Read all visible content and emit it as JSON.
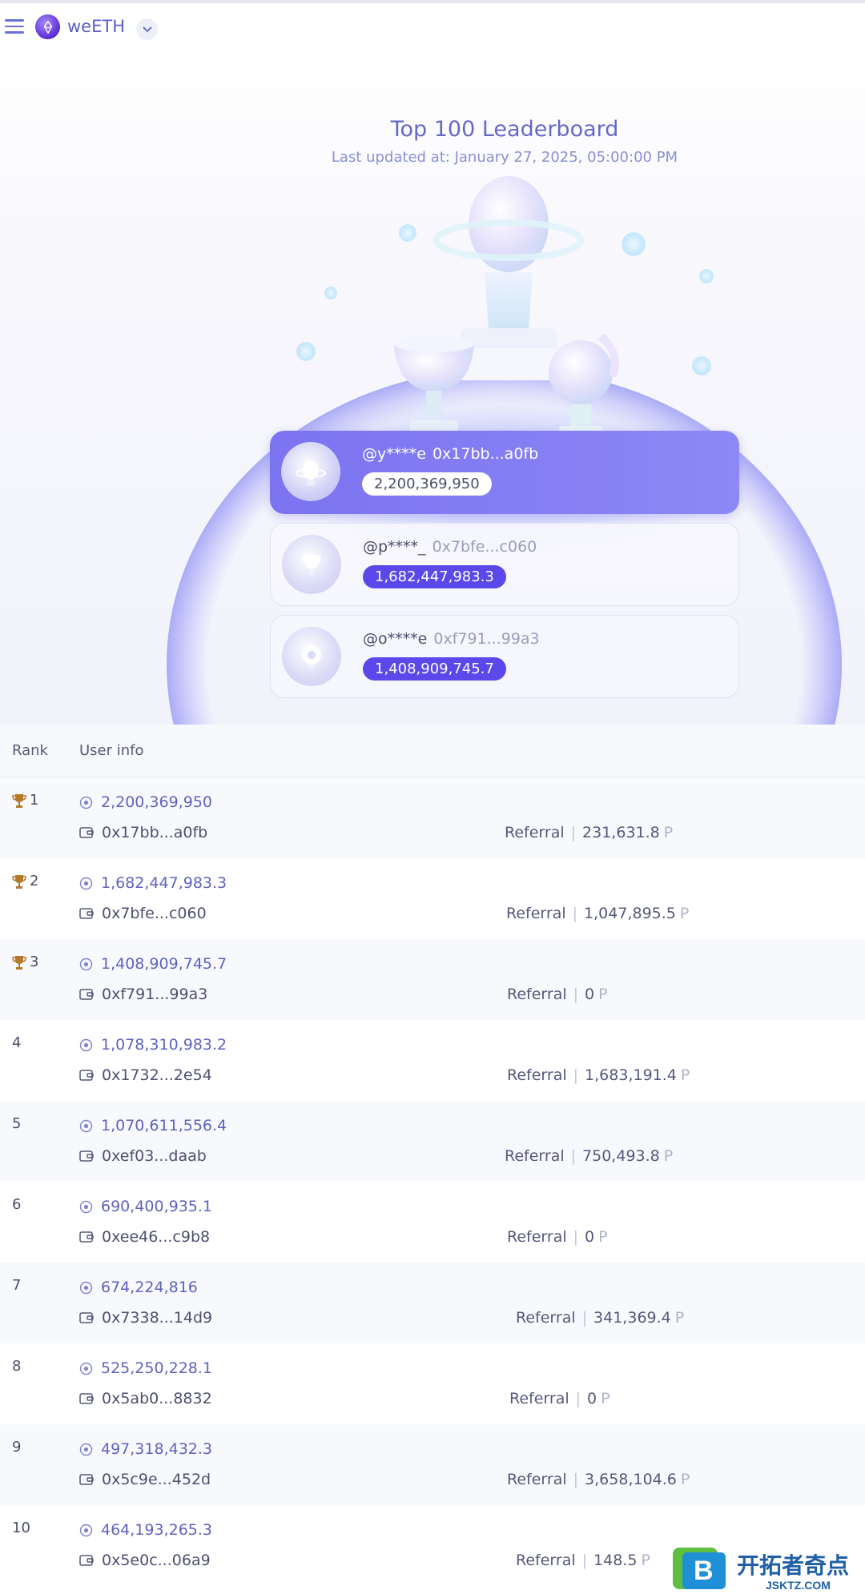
{
  "header": {
    "token": "weETH"
  },
  "hero": {
    "title": "Top 100 Leaderboard",
    "subtitle": "Last updated at: January 27, 2025, 05:00:00 PM"
  },
  "podium": [
    {
      "handle": "@y****e",
      "address": "0x17bb...a0fb",
      "score": "2,200,369,950"
    },
    {
      "handle": "@p****_",
      "address": "0x7bfe...c060",
      "score": "1,682,447,983.3"
    },
    {
      "handle": "@o****e",
      "address": "0xf791...99a3",
      "score": "1,408,909,745.7"
    }
  ],
  "table": {
    "col_rank": "Rank",
    "col_user": "User info",
    "referral_label": "Referral",
    "unit": "P",
    "rows": [
      {
        "rank": "1",
        "trophy": true,
        "points": "2,200,369,950",
        "address": "0x17bb...a0fb",
        "referral": "231,631.8"
      },
      {
        "rank": "2",
        "trophy": true,
        "points": "1,682,447,983.3",
        "address": "0x7bfe...c060",
        "referral": "1,047,895.5"
      },
      {
        "rank": "3",
        "trophy": true,
        "points": "1,408,909,745.7",
        "address": "0xf791...99a3",
        "referral": "0"
      },
      {
        "rank": "4",
        "trophy": false,
        "points": "1,078,310,983.2",
        "address": "0x1732...2e54",
        "referral": "1,683,191.4"
      },
      {
        "rank": "5",
        "trophy": false,
        "points": "1,070,611,556.4",
        "address": "0xef03...daab",
        "referral": "750,493.8"
      },
      {
        "rank": "6",
        "trophy": false,
        "points": "690,400,935.1",
        "address": "0xee46...c9b8",
        "referral": "0"
      },
      {
        "rank": "7",
        "trophy": false,
        "points": "674,224,816",
        "address": "0x7338...14d9",
        "referral": "341,369.4"
      },
      {
        "rank": "8",
        "trophy": false,
        "points": "525,250,228.1",
        "address": "0x5ab0...8832",
        "referral": "0"
      },
      {
        "rank": "9",
        "trophy": false,
        "points": "497,318,432.3",
        "address": "0x5c9e...452d",
        "referral": "3,658,104.6"
      },
      {
        "rank": "10",
        "trophy": false,
        "points": "464,193,265.3",
        "address": "0x5e0c...06a9",
        "referral": "148.5"
      }
    ]
  },
  "watermark": {
    "cn": "开拓者奇点",
    "en": "JSKTZ.COM",
    "letter": "B"
  },
  "colors": {
    "accent": "#5b48ea",
    "primary_text": "#5f63c0",
    "trophy": "#b5792a"
  }
}
